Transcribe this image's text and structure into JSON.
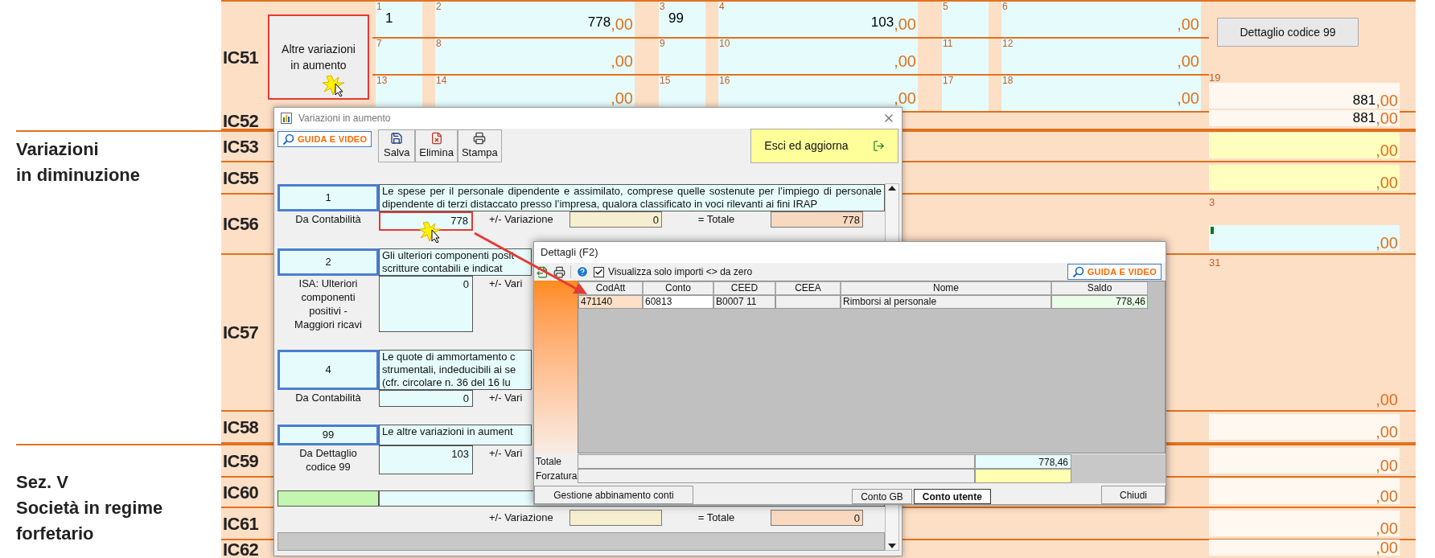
{
  "ic51": {
    "code": "IC51",
    "button": "Altre variazioni in aumento",
    "highlighted": true,
    "field_rows": [
      [
        {
          "kind": "code",
          "number": "1",
          "value": "1"
        },
        {
          "kind": "amount",
          "number": "2",
          "value": "778",
          "decimals": ",00"
        },
        {
          "kind": "code",
          "number": "3",
          "value": "99"
        },
        {
          "kind": "amount",
          "number": "4",
          "value": "103",
          "decimals": ",00"
        },
        {
          "kind": "code",
          "number": "5"
        },
        {
          "kind": "amount",
          "number": "6",
          "decimals": ",00"
        }
      ],
      [
        {
          "kind": "code",
          "number": "7"
        },
        {
          "kind": "amount",
          "number": "8",
          "decimals": ",00"
        },
        {
          "kind": "code",
          "number": "9"
        },
        {
          "kind": "amount",
          "number": "10",
          "decimals": ",00"
        },
        {
          "kind": "code",
          "number": "11"
        },
        {
          "kind": "amount",
          "number": "12",
          "decimals": ",00"
        }
      ],
      [
        {
          "kind": "code",
          "number": "13"
        },
        {
          "kind": "amount",
          "number": "14",
          "decimals": ",00"
        },
        {
          "kind": "code",
          "number": "15"
        },
        {
          "kind": "amount",
          "number": "16",
          "decimals": ",00"
        },
        {
          "kind": "code",
          "number": "17"
        },
        {
          "kind": "amount",
          "number": "18",
          "decimals": ",00"
        }
      ]
    ],
    "detail_button": "Dettaglio codice 99",
    "total": {
      "kind": "plain",
      "number": "19",
      "value": "881",
      "decimals": ",00"
    }
  },
  "ic52": {
    "code": "IC52",
    "field": {
      "kind": "plain",
      "value": "881",
      "decimals": ",00"
    }
  },
  "sections": [
    {
      "title": "Variazioni\nin diminuzione",
      "rows": [
        {
          "code": "IC53",
          "field": {
            "kind": "yellow",
            "decimals": ",00"
          }
        },
        {
          "code": "IC55",
          "field": {
            "kind": "yellow",
            "decimals": ",00"
          }
        },
        {
          "code": "IC56",
          "field": {
            "kind": "cyan",
            "number": "3",
            "caret": true,
            "decimals": ",00"
          }
        },
        {
          "code": "IC57",
          "field": {
            "kind": "peach",
            "number": "31",
            "decimals": ",00"
          }
        },
        {
          "code": "IC58",
          "field": {
            "kind": "plain",
            "decimals": ",00"
          }
        }
      ]
    },
    {
      "title": "Sez. V\nSocietà in regime\nforfetario",
      "rows": [
        {
          "code": "IC59",
          "field": {
            "kind": "plain",
            "decimals": ",00"
          }
        },
        {
          "code": "IC60",
          "field": {
            "kind": "plain",
            "decimals": ",00"
          }
        },
        {
          "code": "IC61",
          "field": {
            "kind": "plain",
            "decimals": ",00"
          }
        },
        {
          "code": "IC62",
          "field": {
            "kind": "plain",
            "decimals": ",00"
          }
        }
      ]
    }
  ],
  "variazioni_dialog": {
    "title": "Variazioni in aumento",
    "guide_button": "GUIDA E VIDEO",
    "toolbar": [
      {
        "kind": "save",
        "label": "Salva"
      },
      {
        "kind": "delete",
        "label": "Elimina"
      },
      {
        "kind": "print",
        "label": "Stampa"
      }
    ],
    "exit_button": "Esci ed aggiorna",
    "items": [
      {
        "kind": "item",
        "code": "1",
        "description": "Le spese per il personale dipendente e assimilato, comprese quelle sostenute per l’impiego di personale dipendente di terzi distaccato presso l’impresa, qualora classificato in voci rilevanti ai fini IRAP",
        "source_label": "Da Contabilità",
        "source_value": "778",
        "highlighted": true,
        "variation_label": "+/- Variazione",
        "variation_value": "0",
        "total_label": "= Totale",
        "total_value": "778"
      },
      {
        "kind": "item",
        "code": "2",
        "description": "Gli ulteriori componenti posit\nscritture contabili e indicat",
        "source_label": "ISA: Ulteriori\ncomponenti\npositivi -\nMaggiori ricavi",
        "source_value": "0",
        "highlighted": false,
        "variation_label": "+/- Vari"
      },
      {
        "kind": "item",
        "code": "4",
        "description": "Le quote di ammortamento c\nstrumentali, indeducibili ai se\n(cfr. circolare n. 36 del 16 lu",
        "source_label": "Da Contabilità",
        "source_value": "0",
        "highlighted": false,
        "variation_label": "+/- Vari"
      },
      {
        "kind": "item",
        "code": "99",
        "description": "Le altre variazioni in aument",
        "source_label": "Da Dettaglio\ncodice 99",
        "source_value": "103",
        "highlighted": false,
        "variation_label": "+/- Vari"
      },
      {
        "kind": "blank",
        "variation_label": "+/- Variazione",
        "total_label": "= Totale",
        "total_value": "0"
      }
    ]
  },
  "details_dialog": {
    "title": "Dettagli (F2)",
    "show_nonzero": {
      "label": "Visualizza solo importi <> da zero",
      "checked": true
    },
    "guide_button": "GUIDA E VIDEO",
    "columns": [
      "CodAtt",
      "Conto",
      "CEED",
      "CEEA",
      "Nome",
      "Saldo"
    ],
    "rows": [
      {
        "codatt": "471140",
        "conto": "60813",
        "ceed": "B0007 11",
        "nome": "Rimborsi al personale",
        "saldo": "778,46"
      }
    ],
    "total_label": "Totale",
    "total_value": "778,46",
    "override_label": "Forzatura",
    "manage_button": "Gestione abbinamento conti",
    "tabs": [
      {
        "label": "Conto GB",
        "selected": false
      },
      {
        "label": "Conto utente",
        "selected": true
      }
    ],
    "close_button": "Chiudi"
  }
}
